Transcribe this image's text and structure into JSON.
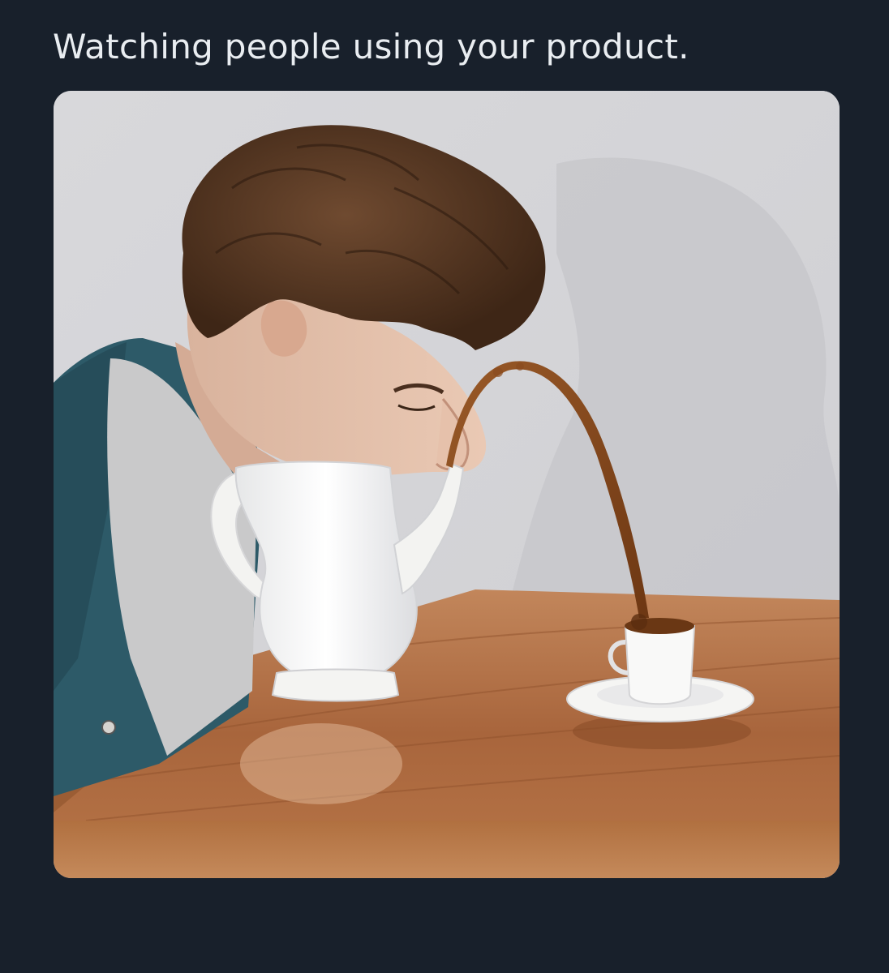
{
  "tweet": {
    "text": "Watching people using your product."
  },
  "media": {
    "kind": "photo"
  },
  "colors": {
    "page_background": "#18202b",
    "tweet_text": "#e9edf1",
    "wall": "#d4d4d7",
    "table_wood": "#a8653c",
    "cardigan": "#2d5a68",
    "hair": "#5a3824",
    "coffee": "#8a4b1f",
    "porcelain": "#f7f7f5"
  }
}
